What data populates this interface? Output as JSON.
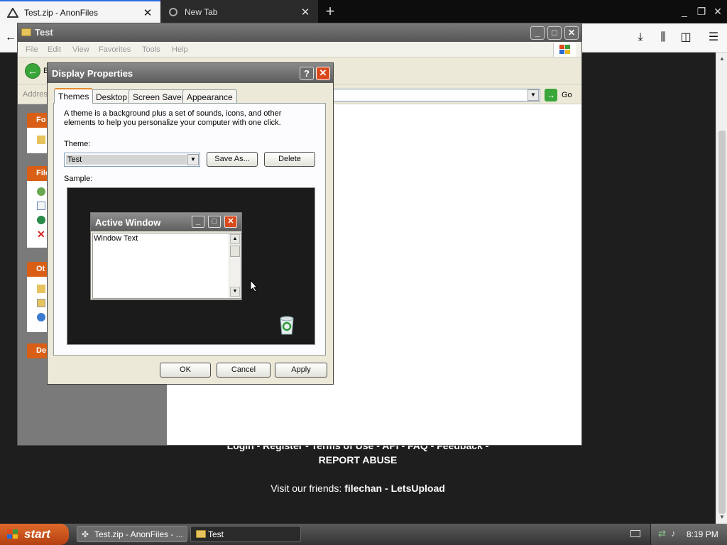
{
  "browser": {
    "tabs": [
      {
        "title": "Test.zip - AnonFiles",
        "active": true
      },
      {
        "title": "New Tab",
        "active": false
      }
    ]
  },
  "webpage": {
    "footer_links": "Login - Register - Terms of Use - API - FAQ - Feedback -",
    "report_abuse": "REPORT ABUSE",
    "friends_prefix": "Visit our friends:",
    "friend_1": "filechan",
    "friend_sep": "-",
    "friend_2": "LetsUpload"
  },
  "explorer": {
    "title": "Test",
    "menu": [
      "File",
      "Edit",
      "View",
      "Favorites",
      "Tools",
      "Help"
    ],
    "back_label": "B",
    "address_label": "Address",
    "go_label": "Go",
    "task_headers": [
      "Fo",
      "File",
      "Ot",
      "De"
    ]
  },
  "dialog": {
    "title": "Display Properties",
    "help": "?",
    "tabs": [
      "Themes",
      "Desktop",
      "Screen Saver",
      "Appearance"
    ],
    "description": "A theme is a background plus a set of sounds, icons, and other elements to help you personalize your computer with one click.",
    "theme_label": "Theme:",
    "theme_value": "Test",
    "save_as": "Save As...",
    "delete": "Delete",
    "sample_label": "Sample:",
    "sample_window_title": "Active Window",
    "sample_window_text": "Window Text",
    "ok": "OK",
    "cancel": "Cancel",
    "apply": "Apply"
  },
  "taskbar": {
    "start": "start",
    "tasks": [
      {
        "label": "Test.zip - AnonFiles - ..."
      },
      {
        "label": "Test"
      }
    ],
    "clock": "8:19 PM"
  },
  "colors": {
    "start_button": "#d0561c",
    "close_button": "#d9491c",
    "active_tab_accent": "#e68b2c"
  }
}
